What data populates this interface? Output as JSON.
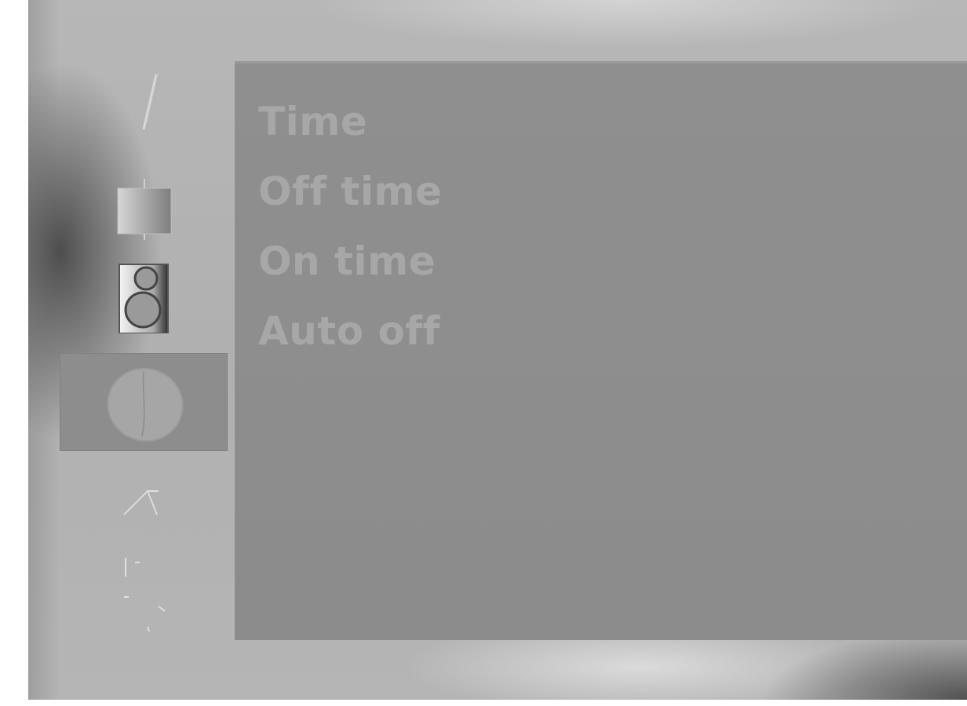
{
  "menu": {
    "items": [
      {
        "label": "Time"
      },
      {
        "label": "Off time"
      },
      {
        "label": "On time"
      },
      {
        "label": "Auto off"
      }
    ]
  },
  "sidebar": {
    "items": [
      {
        "icon": "slash-icon",
        "selected": false
      },
      {
        "icon": "square-icon",
        "selected": false
      },
      {
        "icon": "speaker-icon",
        "selected": false
      },
      {
        "icon": "clock-icon",
        "selected": true
      },
      {
        "icon": "tent-icon",
        "selected": false
      },
      {
        "icon": "lock-icon",
        "selected": false
      }
    ]
  },
  "colors": {
    "menu_text": "#a7a7a7",
    "panel_bg": "#8f8f8f",
    "frame_bg": "#b5b5b5",
    "selected_bg": "#8d8d8d"
  }
}
